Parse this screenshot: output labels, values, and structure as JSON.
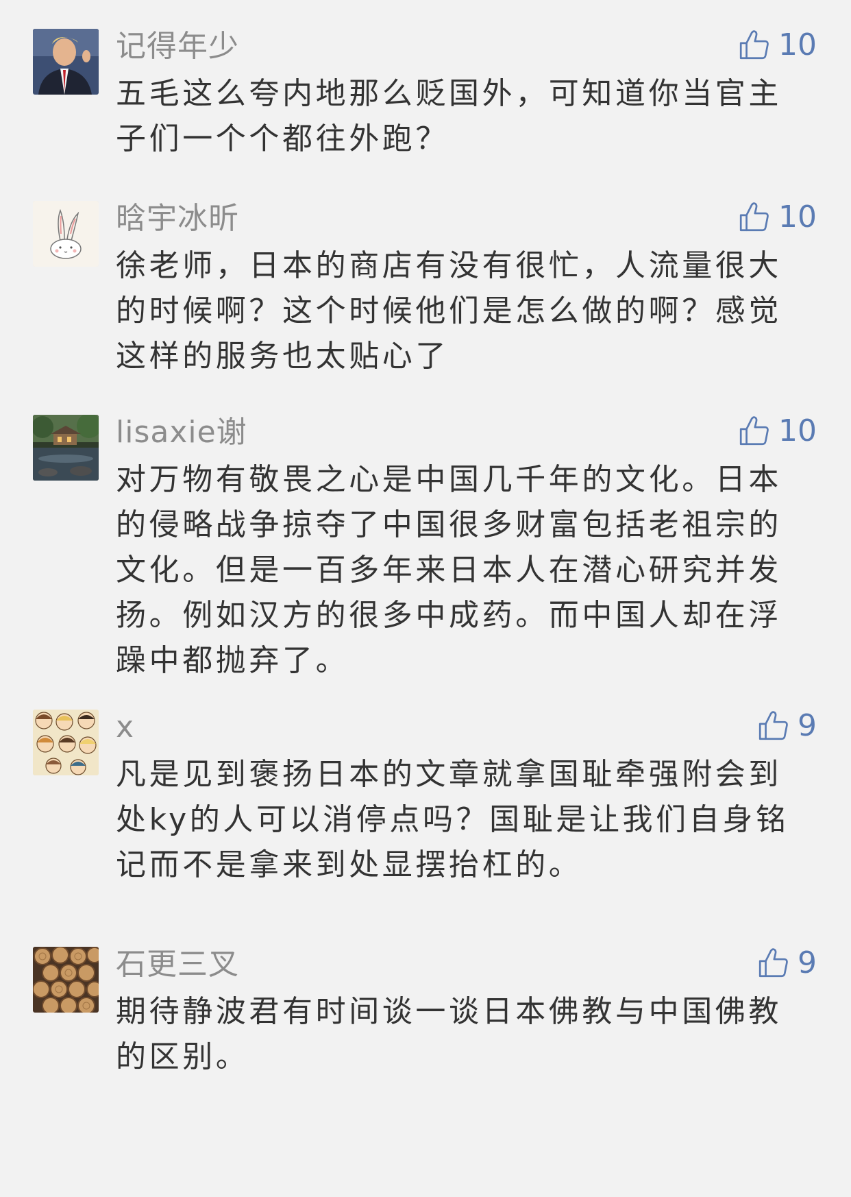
{
  "comments": [
    {
      "nickname": "记得年少",
      "likes": "10",
      "avatar_icon": "man-in-suit-avatar-icon",
      "content": "五毛这么夸内地那么贬国外，可知道你当官主子们一个个都往外跑？"
    },
    {
      "nickname": "晗宇冰昕",
      "likes": "10",
      "avatar_icon": "rabbit-sketch-avatar-icon",
      "content": "徐老师，日本的商店有没有很忙，人流量很大的时候啊？这个时候他们是怎么做的啊？感觉这样的服务也太贴心了"
    },
    {
      "nickname": "lisaxie谢",
      "likes": "10",
      "avatar_icon": "garden-pond-avatar-icon",
      "content": "对万物有敬畏之心是中国几千年的文化。日本的侵略战争掠夺了中国很多财富包括老祖宗的文化。但是一百多年来日本人在潜心研究并发扬。例如汉方的很多中成药。而中国人却在浮躁中都抛弃了。"
    },
    {
      "nickname": "x",
      "likes": "9",
      "avatar_icon": "cartoon-group-avatar-icon",
      "content": "凡是见到褒扬日本的文章就拿国耻牵强附会到处ky的人可以消停点吗？国耻是让我们自身铭记而不是拿来到处显摆抬杠的。"
    },
    {
      "nickname": "石更三叉",
      "likes": "9",
      "avatar_icon": "log-pile-avatar-icon",
      "content": "期待静波君有时间谈一谈日本佛教与中国佛教的区别。"
    }
  ],
  "colors": {
    "background": "#f2f2f2",
    "nickname": "#8c8c8c",
    "content": "#333333",
    "like_accent": "#5a7bb3"
  },
  "like_icon": "thumbs-up-icon"
}
